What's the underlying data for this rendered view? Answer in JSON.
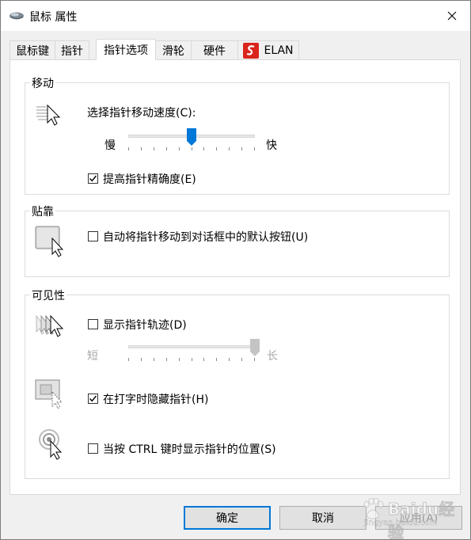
{
  "window": {
    "title": "鼠标 属性"
  },
  "tabs": [
    {
      "label": "鼠标键"
    },
    {
      "label": "指针"
    },
    {
      "label": "指针选项",
      "active": true
    },
    {
      "label": "滑轮"
    },
    {
      "label": "硬件"
    },
    {
      "label": "ELAN"
    }
  ],
  "motion": {
    "title": "移动",
    "speed_label": "选择指针移动速度(C):",
    "slow_label": "慢",
    "fast_label": "快",
    "speed_value": 0.5,
    "enhance_label": "提高指针精确度(E)",
    "enhance_checked": true
  },
  "snap_to": {
    "title": "贴靠",
    "auto_label": "自动将指针移动到对话框中的默认按钮(U)",
    "auto_checked": false
  },
  "visibility": {
    "title": "可见性",
    "trails_label": "显示指针轨迹(D)",
    "trails_checked": false,
    "short_label": "短",
    "long_label": "长",
    "trails_value": 1.0,
    "hide_typing_label": "在打字时隐藏指针(H)",
    "hide_typing_checked": true,
    "ctrl_label": "当按 CTRL 键时显示指针的位置(S)",
    "ctrl_checked": false
  },
  "buttons": {
    "ok_label": "确定",
    "cancel_label": "取消",
    "apply_label": "应用(A)"
  },
  "watermark": {
    "text": "Baidu经验",
    "sub": "jingyan.baidu.com"
  },
  "colors": {
    "accent": "#0078d7",
    "elan_red": "#d9251c"
  }
}
